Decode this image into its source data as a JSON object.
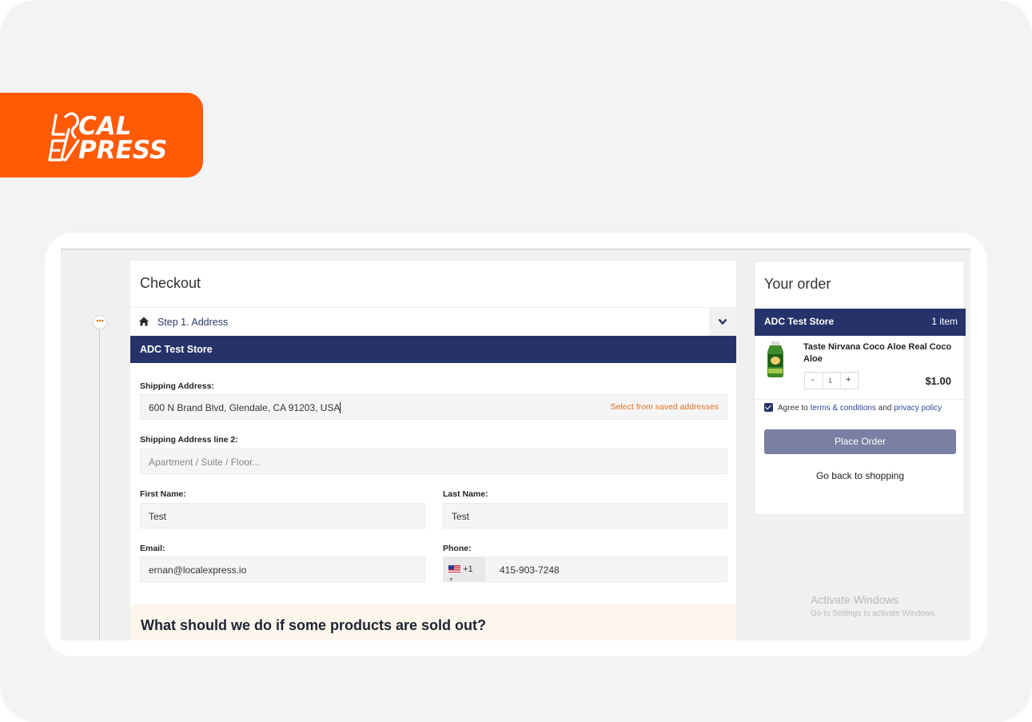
{
  "brand": {
    "logo_line1": "L  CAL",
    "logo_line2": "E  PRESS",
    "logo_text": "LOCAL EXPRESS",
    "color": "#ff5a06"
  },
  "checkout": {
    "title": "Checkout",
    "step_label": "Step 1. Address",
    "store_name": "ADC Test Store",
    "shipping_address": {
      "label": "Shipping Address:",
      "value": "600 N Brand Blvd, Glendale, CA 91203, USA",
      "saved_link": "Select from saved addresses"
    },
    "shipping_address_2": {
      "label": "Shipping Address line 2:",
      "placeholder": "Apartment / Suite / Floor..."
    },
    "first_name": {
      "label": "First Name:",
      "value": "Test"
    },
    "last_name": {
      "label": "Last Name:",
      "value": "Test"
    },
    "email": {
      "label": "Email:",
      "value": "ernan@localexpress.io"
    },
    "phone": {
      "label": "Phone:",
      "country_code": "+1",
      "value": "415-903-7248"
    },
    "sold_out_question": "What should we do if some products are sold out?"
  },
  "order": {
    "title": "Your order",
    "store_name": "ADC Test Store",
    "item_count": "1 item",
    "product_name": "Taste Nirvana Coco Aloe Real Coco Aloe",
    "qty_minus": "-",
    "quantity": "1",
    "qty_plus": "+",
    "price": "$1.00",
    "agree_prefix": "Agree to ",
    "terms_link": "terms & conditions",
    "agree_and": " and ",
    "privacy_link": "privacy policy",
    "place_order": "Place Order",
    "back_to_shopping": "Go back to shopping"
  },
  "watermark": {
    "title": "Activate Windows",
    "subtitle": "Go to Settings to activate Windows."
  },
  "colors": {
    "navy": "#26336a",
    "accent_orange": "#e0701e",
    "button_disabled": "#7a80a3"
  }
}
